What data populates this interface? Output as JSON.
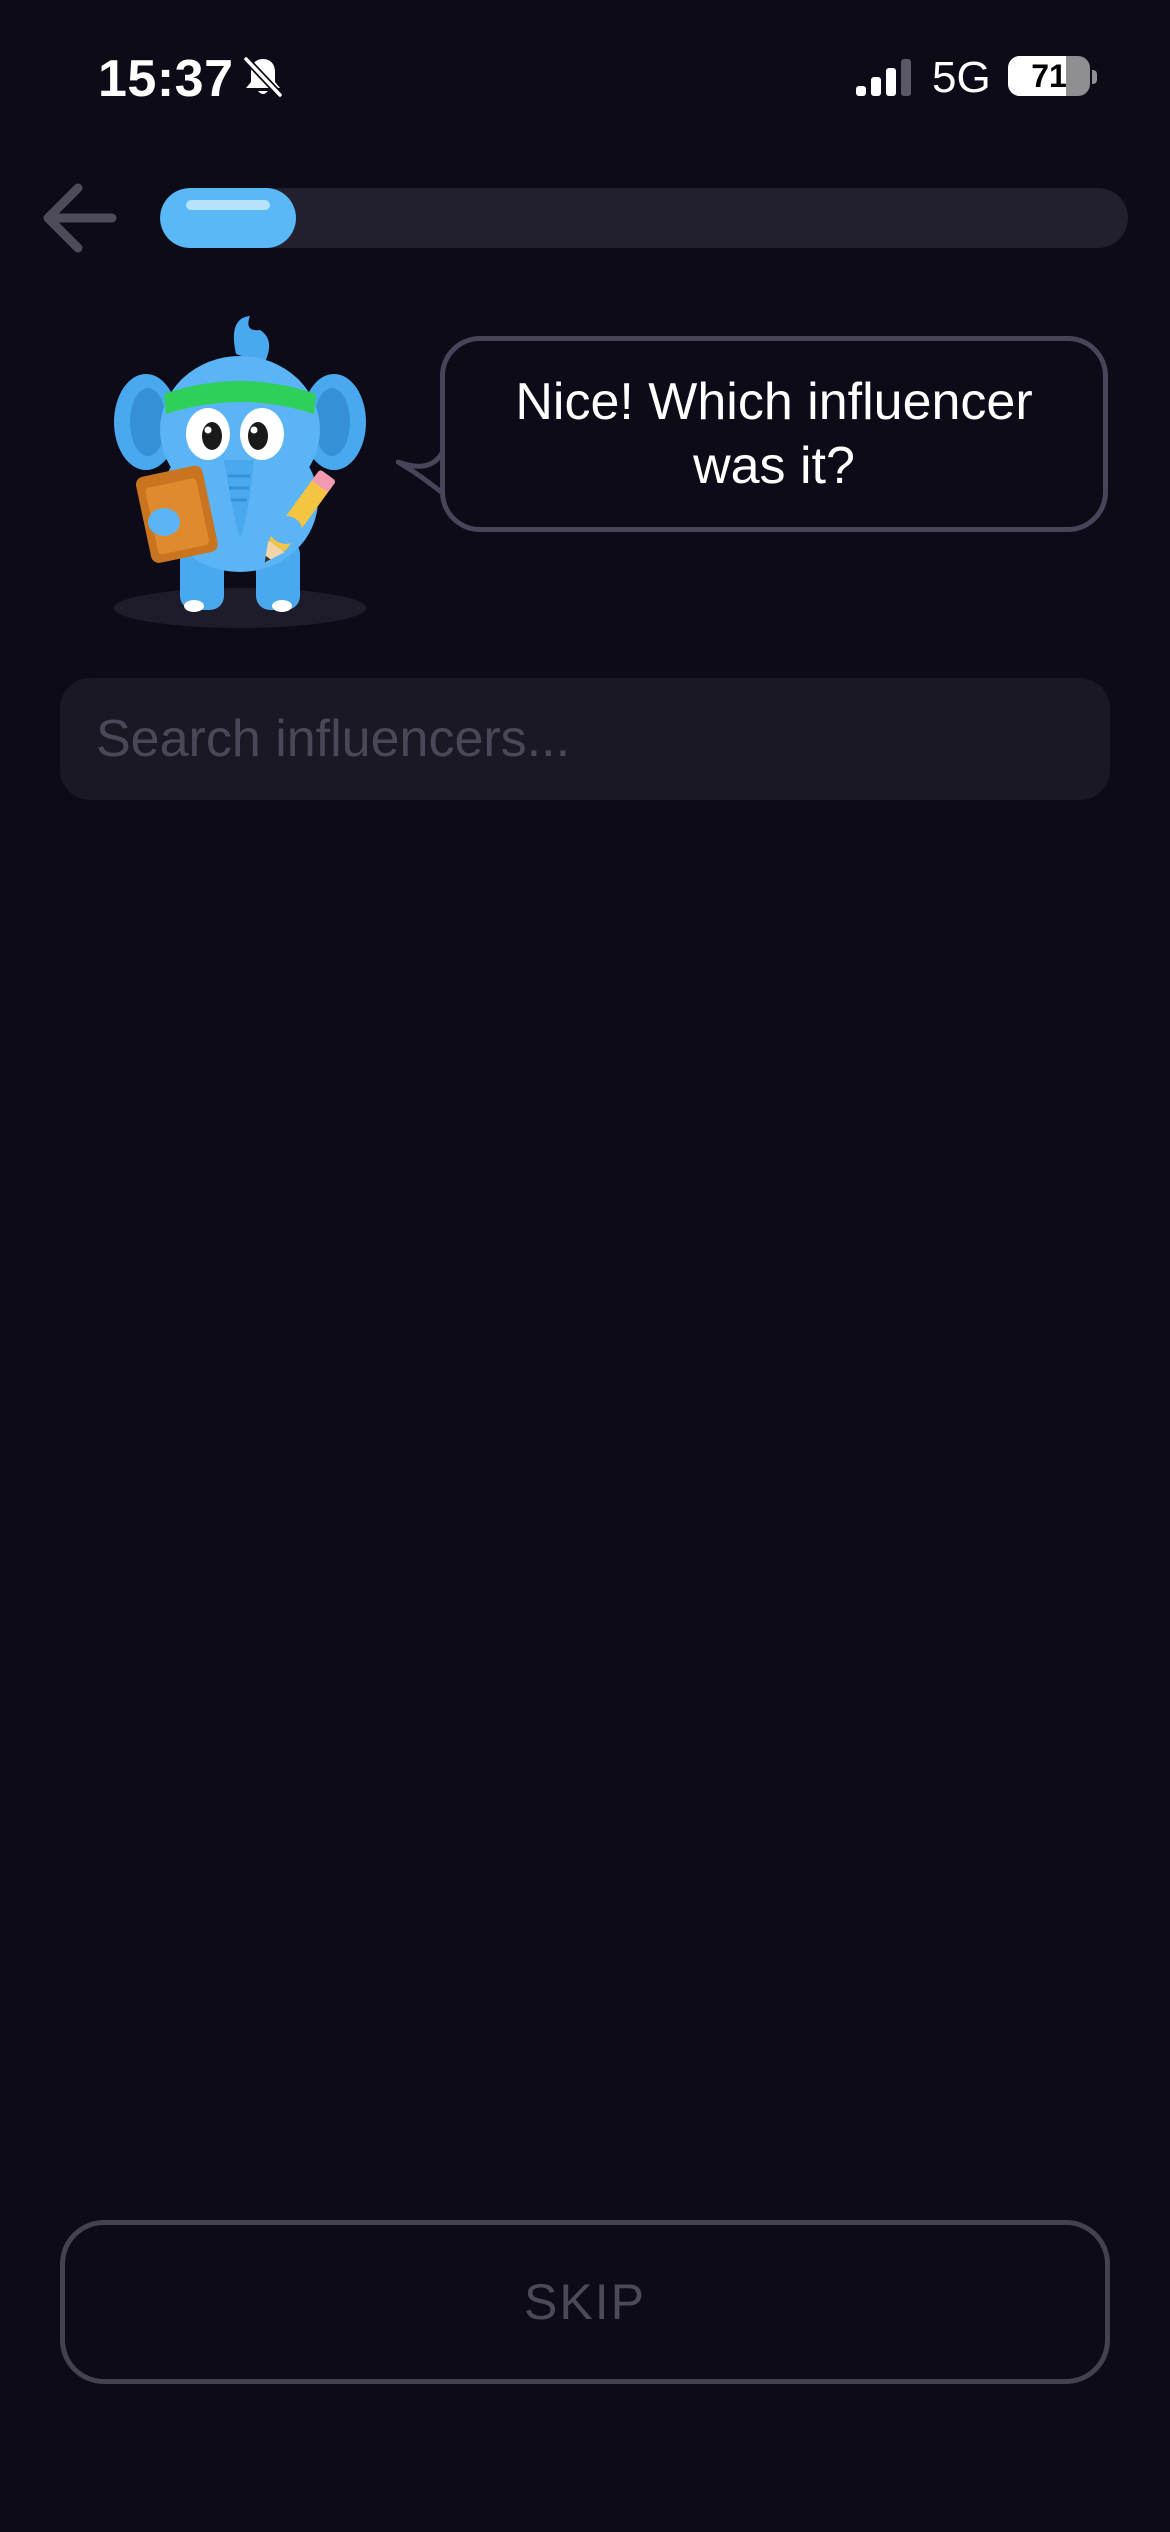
{
  "status_bar": {
    "time": "15:37",
    "network": "5G",
    "battery_percent": "71",
    "battery_level": 0.71,
    "signal_bars_filled": 3,
    "signal_bars_total": 4,
    "icons": [
      "bell-slash-icon",
      "cellular-signal-icon",
      "battery-icon"
    ]
  },
  "header": {
    "back_icon": "arrow-left-icon",
    "progress": 0.14
  },
  "prompt": {
    "mascot": "elephant-mascot",
    "message": "Nice! Which influencer was it?"
  },
  "search": {
    "placeholder": "Search influencers...",
    "value": ""
  },
  "footer": {
    "skip_label": "SKIP"
  },
  "colors": {
    "background": "#0d0b17",
    "accent": "#59b8f5",
    "track": "#221f2e",
    "border": "#48455a",
    "muted_text": "#4c4959"
  }
}
